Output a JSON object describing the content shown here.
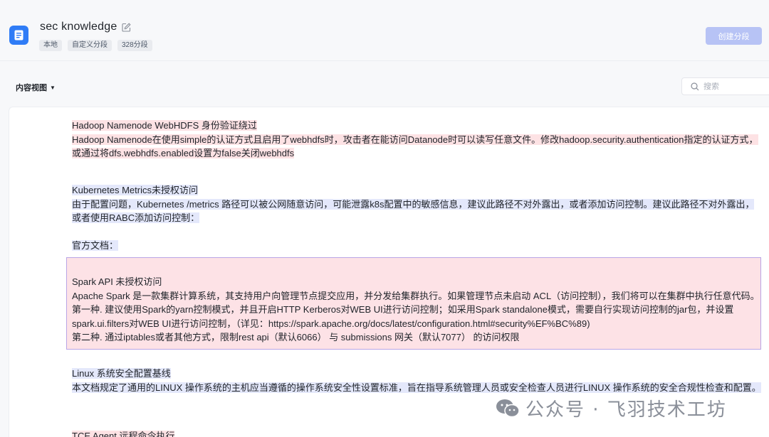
{
  "header": {
    "title": "sec knowledge",
    "tags": [
      "本地",
      "自定义分段",
      "328分段"
    ],
    "create_button": "创建分段"
  },
  "toolbar": {
    "view_label": "内容视图",
    "search_placeholder": "搜索"
  },
  "chunks": [
    {
      "title": "Hadoop Namenode WebHDFS 身份验证绕过",
      "body": "Hadoop Namenode在使用simple的认证方式且启用了webhdfs时，攻击者在能访问Datanode时可以读写任意文件。修改hadoop.security.authentication指定的认证方式，或通过将dfs.webhdfs.enabled设置为false关闭webhdfs"
    },
    {
      "title": "Kubernetes Metrics未授权访问",
      "body": "由于配置问题，Kubernetes /metrics 路径可以被公网随意访问，可能泄露k8s配置中的敏感信息，建议此路径不对外露出，或者添加访问控制。建议此路径不对外露出，或者使用RABC添加访问控制：",
      "extra": "官方文档："
    },
    {
      "title": "Spark API 未授权访问",
      "body": "Apache Spark 是一款集群计算系统，其支持用户向管理节点提交应用，并分发给集群执行。如果管理节点未启动 ACL（访问控制），我们将可以在集群中执行任意代码。第一种. 建议使用Spark的yarn控制模式，并且开启HTTP Kerberos对WEB UI进行访问控制；如采用Spark standalone模式，需要自行实现访问控制的jar包，并设置spark.ui.filters对WEB UI进行访问控制，（详见：https://spark.apache.org/docs/latest/configuration.html#security%EF%BC%89)",
      "body2": "第二种. 通过iptables或者其他方式，限制rest api（默认6066） 与 submissions 网关（默认7077） 的访问权限"
    },
    {
      "title": "Linux 系统安全配置基线",
      "body": "本文档规定了通用的LINUX 操作系统的主机应当遵循的操作系统安全性设置标准，旨在指导系统管理人员或安全检查人员进行LINUX 操作系统的安全合规性检查和配置。"
    },
    {
      "title": "TCE Agent 远程命令执行"
    }
  ],
  "watermark": "公众号 · 飞羽技术工坊",
  "colors": {
    "accent": "#2f7cf6",
    "button_disabled": "#b7c3f5",
    "highlight_pink": "#fde2e4",
    "highlight_blue": "#e4e8fb",
    "selected_border": "#b9a5e6"
  }
}
